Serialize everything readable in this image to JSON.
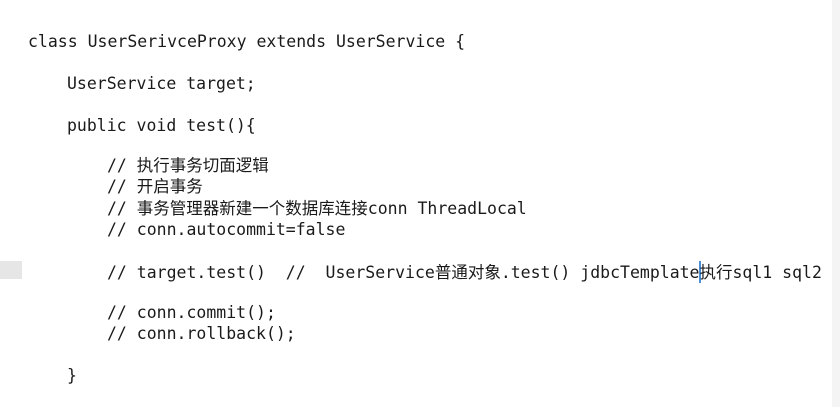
{
  "code": {
    "line_class": "class UserSerivceProxy extends UserService {",
    "line_field": "UserService target;",
    "line_method": "public void test(){",
    "comment_1": "// 执行事务切面逻辑",
    "comment_2": "// 开启事务",
    "comment_3": "// 事务管理器新建一个数据库连接conn ThreadLocal",
    "comment_4": "// conn.autocommit=false",
    "line_target_before_caret": "// target.test()  //  UserService普通对象.test() jdbcTemplate",
    "line_target_after_caret": "执行sql1 sql2",
    "comment_commit": "// conn.commit();",
    "comment_rollback": "// conn.rollback();",
    "line_close": "}"
  }
}
